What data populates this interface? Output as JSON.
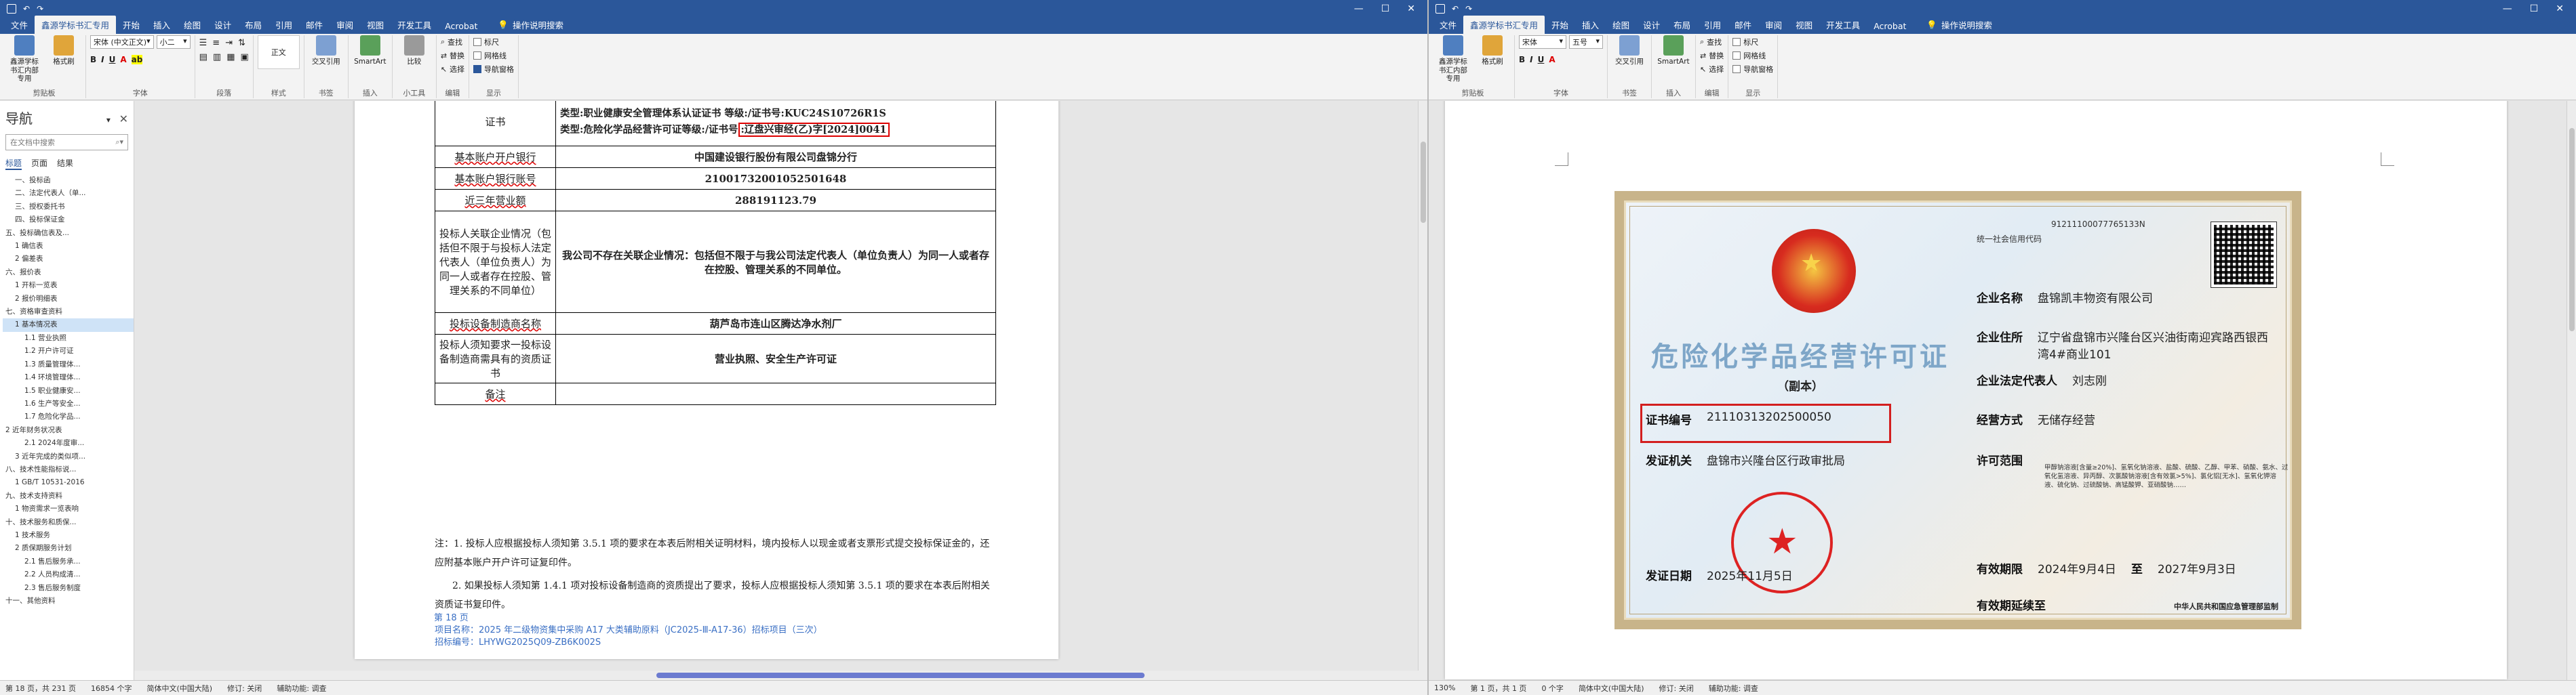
{
  "left": {
    "title": "",
    "tabs": [
      "文件",
      "鑫源学标书汇专用",
      "开始",
      "插入",
      "绘图",
      "设计",
      "布局",
      "引用",
      "邮件",
      "审阅",
      "视图",
      "开发工具",
      "Acrobat"
    ],
    "tell_me": "操作说明搜索",
    "ribbon": {
      "btn_guide": "鑫源学标书汇内部专用",
      "btn_format": "格式刷",
      "grp_clip": "剪贴板",
      "font_name": "宋体 (中文正文)",
      "font_size": "小二",
      "grp_font": "字体",
      "grp_para": "段落",
      "grp_style": "样式",
      "style_normal": "正文",
      "btn_crossref": "交叉引用",
      "grp_book": "书签",
      "btn_smartart": "SmartArt",
      "grp_insert": "插入",
      "btn_compare": "比较",
      "grp_tool": "小工具",
      "find": "查找",
      "replace": "替换",
      "select": "选择",
      "grp_edit": "编辑",
      "ruler": "标尺",
      "grid": "网格线",
      "navpane": "导航窗格",
      "grp_show": "显示"
    },
    "nav": {
      "title": "导航",
      "search_placeholder": "在文档中搜索",
      "tab_headings": "标题",
      "tab_pages": "页面",
      "tab_results": "结果",
      "items": [
        {
          "t": "一、投标函",
          "lv": 2
        },
        {
          "t": "二、法定代表人（单...",
          "lv": 2
        },
        {
          "t": "三、授权委托书",
          "lv": 2
        },
        {
          "t": "四、投标保证金",
          "lv": 2
        },
        {
          "t": "五、投标确信表及...",
          "lv": 1
        },
        {
          "t": "1 确信表",
          "lv": 2
        },
        {
          "t": "2 偏差表",
          "lv": 2
        },
        {
          "t": "六、报价表",
          "lv": 1
        },
        {
          "t": "1 开标一览表",
          "lv": 2
        },
        {
          "t": "2 报价明细表",
          "lv": 2
        },
        {
          "t": "七、资格审查资料",
          "lv": 1
        },
        {
          "t": "1 基本情况表",
          "lv": 2,
          "sel": true
        },
        {
          "t": "1.1 营业执照",
          "lv": 3
        },
        {
          "t": "1.2 开户许可证",
          "lv": 3
        },
        {
          "t": "1.3 质量管理体...",
          "lv": 3
        },
        {
          "t": "1.4 环境管理体...",
          "lv": 3
        },
        {
          "t": "1.5 职业健康安...",
          "lv": 3
        },
        {
          "t": "1.6 生产等安全...",
          "lv": 3
        },
        {
          "t": "1.7 危险化学品...",
          "lv": 3
        },
        {
          "t": "2 近年财务状况表",
          "lv": 1
        },
        {
          "t": "2.1 2024年度审...",
          "lv": 3
        },
        {
          "t": "3 近年完成的类似项...",
          "lv": 2
        },
        {
          "t": "八、技术性能指标说...",
          "lv": 1
        },
        {
          "t": "1 GB/T 10531-2016",
          "lv": 2
        },
        {
          "t": "九、技术支持资料",
          "lv": 1
        },
        {
          "t": "1 物资需求一览表响",
          "lv": 2
        },
        {
          "t": "十、技术服务和质保...",
          "lv": 1
        },
        {
          "t": "1 技术服务",
          "lv": 2
        },
        {
          "t": "2 质保期服务计划",
          "lv": 2
        },
        {
          "t": "2.1 售后服务承...",
          "lv": 3
        },
        {
          "t": "2.2 人员构成清...",
          "lv": 3
        },
        {
          "t": "2.3 售后服务制度",
          "lv": 3
        },
        {
          "t": "十一、其他资料",
          "lv": 1
        }
      ]
    },
    "doc": {
      "cert_label": "证书",
      "cert_line1": "类型:职业健康安全管理体系认证证书 等级:/证书号:KUC24S10726R1S",
      "cert_line2_a": "类型:危险化学品经营许可证等级:/证书号",
      "cert_line2_b": ":辽盘兴审经(乙)字[2024]0041",
      "rows": [
        {
          "label": "基本账户开户银行",
          "value": "中国建设银行股份有限公司盘锦分行",
          "red": true
        },
        {
          "label": "基本账户银行账号",
          "value": "21001732001052501648",
          "red": true
        },
        {
          "label": "近三年营业额",
          "value": "288191123.79",
          "red": true
        },
        {
          "label": "投标人关联企业情况（包括但不限于与投标人法定代表人（单位负责人）为同一人或者存在控股、管理关系的不同单位）",
          "value": "我公司不存在关联企业情况：包括但不限于与我公司法定代表人（单位负责人）为同一人或者存在控股、管理关系的不同单位。",
          "red": false
        },
        {
          "label": "投标设备制造商名称",
          "value": "葫芦岛市连山区腾达净水剂厂",
          "red": true
        },
        {
          "label": "投标人须知要求一投标设备制造商需具有的资质证书",
          "value": "营业执照、安全生产许可证",
          "red": false
        },
        {
          "label": "备注",
          "value": "",
          "red": true
        }
      ],
      "note1": "注：1. 投标人应根据投标人须知第 3.5.1 项的要求在本表后附相关证明材料，境内投标人以现金或者支票形式提交投标保证金的，还应附基本账户开户许可证复印件。",
      "note2": "2. 如果投标人须知第 1.4.1 项对投标设备制造商的资质提出了要求，投标人应根据投标人须知第 3.5.1 项的要求在本表后附相关资质证书复印件。",
      "footer_page": "第 18 页",
      "footer_proj": "项目名称：2025 年二级物资集中采购 A17 大类辅助原料（JC2025-Ⅲ-A17-36）招标项目（三次）",
      "footer_no": "招标编号：LHYWG2025Q09-ZB6K002S"
    },
    "status": {
      "page": "第 18 页，共 231 页",
      "words": "16854 个字",
      "lang": "简体中文(中国大陆)",
      "track": "修订: 关闭",
      "access": "辅助功能: 调查"
    }
  },
  "right": {
    "tabs": [
      "文件",
      "鑫源学标书汇专用",
      "开始",
      "插入",
      "绘图",
      "设计",
      "布局",
      "引用",
      "邮件",
      "审阅",
      "视图",
      "开发工具",
      "Acrobat"
    ],
    "tell_me": "操作说明搜索",
    "font_name": "宋体",
    "font_size": "五号",
    "status": {
      "zoom": "130%",
      "page": "第 1 页，共 1 页",
      "words": "0 个字",
      "lang": "简体中文(中国大陆)",
      "track": "修订: 关闭",
      "access": "辅助功能: 调查"
    },
    "cert": {
      "credit_label": "统一社会信用代码",
      "credit_code": "91211100077765133N",
      "title": "危险化学品经营许可证",
      "subtitle": "（副本）",
      "company_k": "企业名称",
      "company_v": "盘锦凯丰物资有限公司",
      "addr_k": "企业住所",
      "addr_v": "辽宁省盘锦市兴隆台区兴油街南迎宾路西银西湾4#商业101",
      "legal_k": "企业法定代表人",
      "legal_v": "刘志刚",
      "no_k": "证书编号",
      "no_v": "21110313202500050",
      "mode_k": "经营方式",
      "mode_v": "无储存经营",
      "issuer_k": "发证机关",
      "issuer_v": "盘锦市兴隆台区行政审批局",
      "scope_k": "许可范围",
      "scope_v": "甲醇钠溶液[含量≥20%]、氢氧化钠溶液、盐酸、硫酸、乙醇、甲苯、硝酸、氨水、过氧化氢溶液、异丙醇、次氯酸钠溶液[含有效氯>5%]、氯化铝[无水]、氢氧化钾溶液、硫化钠、过硫酸钠、高锰酸钾、亚硝酸钠……",
      "valid_k": "有效期限",
      "valid_from": "2024年9月4日",
      "valid_to_k": "至",
      "valid_to": "2027年9月3日",
      "date_k": "发证日期",
      "date_v": "2025年11月5日",
      "ext_k": "有效期延续至",
      "foot": "中华人民共和国应急管理部监制"
    }
  }
}
